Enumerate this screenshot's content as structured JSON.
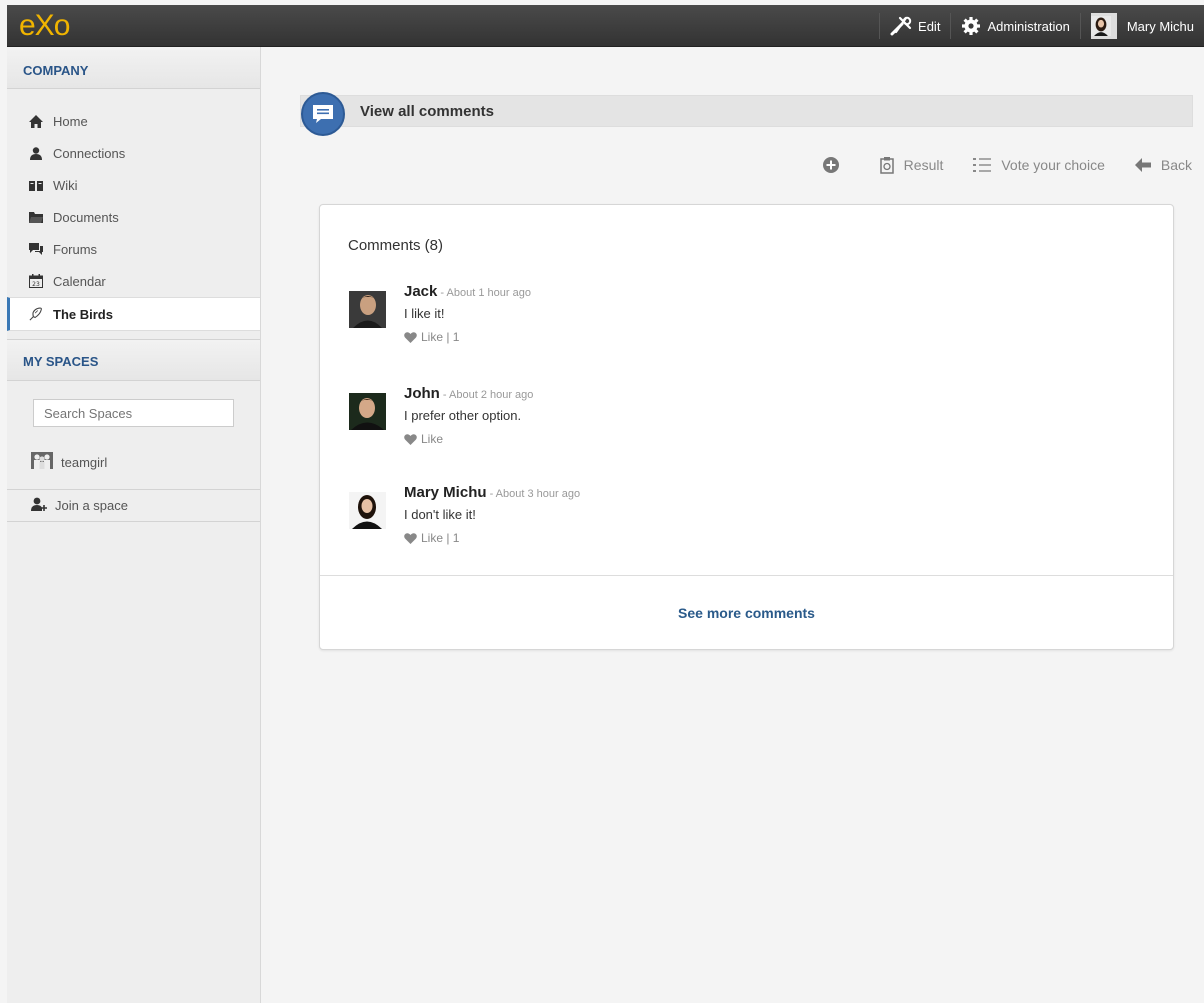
{
  "topbar": {
    "logo": "eXo",
    "edit_label": "Edit",
    "admin_label": "Administration",
    "user_name": "Mary Michu"
  },
  "sidebar": {
    "company_header": "COMPANY",
    "items": [
      {
        "label": "Home",
        "icon": "home-icon"
      },
      {
        "label": "Connections",
        "icon": "user-icon"
      },
      {
        "label": "Wiki",
        "icon": "book-icon"
      },
      {
        "label": "Documents",
        "icon": "folder-icon"
      },
      {
        "label": "Forums",
        "icon": "chat-icon"
      },
      {
        "label": "Calendar",
        "icon": "calendar-icon"
      },
      {
        "label": "The Birds",
        "icon": "bird-icon",
        "active": true
      }
    ],
    "spaces_header": "MY SPACES",
    "search_placeholder": "Search Spaces",
    "spaces": [
      {
        "label": "teamgirl"
      }
    ],
    "join_label": "Join a space"
  },
  "main": {
    "title": "View all comments",
    "actions": {
      "result": "Result",
      "vote": "Vote your choice",
      "back": "Back"
    },
    "comments_title": "Comments (8)",
    "comments": [
      {
        "author": "Jack",
        "time": " - About 1 hour ago",
        "text": "I like it!",
        "like": "Like | 1"
      },
      {
        "author": "John",
        "time": " - About 2 hour ago",
        "text": "I prefer other option.",
        "like": "Like"
      },
      {
        "author": "Mary Michu",
        "time": " - About 3 hour ago",
        "text": "I don't like it!",
        "like": "Like | 1"
      }
    ],
    "see_more": "See more comments"
  },
  "colors": {
    "accent": "#3d6fb0",
    "logo": "#f0b400",
    "header_text": "#2a5588"
  }
}
